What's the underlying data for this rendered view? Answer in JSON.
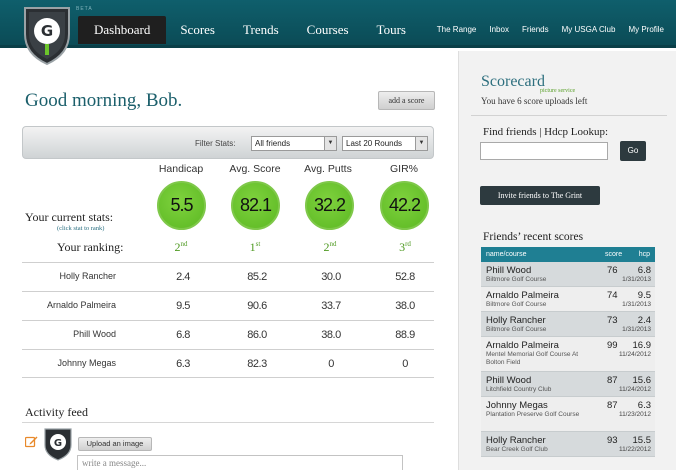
{
  "nav": {
    "items": [
      "Dashboard",
      "Scores",
      "Trends",
      "Courses",
      "Tours"
    ],
    "beta_label": "BETA",
    "utils": [
      "The Range",
      "Inbox",
      "Friends",
      "My USGA Club",
      "My Profile"
    ]
  },
  "colors": {
    "header": "#0b4b56",
    "accent_green": "#6cc52b",
    "teal": "#1f7f93"
  },
  "main": {
    "greeting": "Good morning, Bob.",
    "add_score": "add a score",
    "filter_label": "Filter Stats:",
    "filter_friends": "All friends",
    "filter_rounds": "Last 20 Rounds",
    "stat_heads": [
      "Handicap",
      "Avg. Score",
      "Avg. Putts",
      "GIR%"
    ],
    "current_values": [
      "5.5",
      "82.1",
      "32.2",
      "42.2"
    ],
    "current_label": "Your current stats:",
    "click_note": "(click stat to rank)",
    "ranking_label": "Your ranking:",
    "ranks": [
      {
        "num": "2",
        "suf": "nd"
      },
      {
        "num": "1",
        "suf": "st"
      },
      {
        "num": "2",
        "suf": "nd"
      },
      {
        "num": "3",
        "suf": "rd"
      }
    ],
    "friends": [
      {
        "name": "Holly Rancher",
        "values": [
          "2.4",
          "85.2",
          "30.0",
          "52.8"
        ]
      },
      {
        "name": "Arnaldo Palmeira",
        "values": [
          "9.5",
          "90.6",
          "33.7",
          "38.0"
        ]
      },
      {
        "name": "Phill Wood",
        "values": [
          "6.8",
          "86.0",
          "38.0",
          "88.9"
        ]
      },
      {
        "name": "Johnny Megas",
        "values": [
          "6.3",
          "82.3",
          "0",
          "0"
        ]
      }
    ],
    "activity_title": "Activity feed",
    "upload_label": "Upload an image",
    "message_placeholder": "write a message..."
  },
  "sidebar": {
    "scorecard_title": "Scorecard",
    "picture_service": "picture service",
    "uploads_left": "You have 6 score uploads left",
    "find_title": "Find friends | Hdcp Lookup:",
    "go_label": "Go",
    "invite_label": "Invite friends to The Grint",
    "recent_title": "Friends’ recent scores",
    "recent_headers": {
      "name": "name/course",
      "score": "score",
      "hcp": "hcp"
    },
    "recent": [
      {
        "name": "Phill Wood",
        "course": "Biltmore Golf Course",
        "score": "76",
        "hcp": "6.8",
        "date": "1/31/2013"
      },
      {
        "name": "Arnaldo Palmeira",
        "course": "Biltmore Golf Course",
        "score": "74",
        "hcp": "9.5",
        "date": "1/31/2013"
      },
      {
        "name": "Holly Rancher",
        "course": "Biltmore Golf Course",
        "score": "73",
        "hcp": "2.4",
        "date": "1/31/2013"
      },
      {
        "name": "Arnaldo Palmeira",
        "course": "Mentel Memorial Golf Course At Bolton Field",
        "score": "99",
        "hcp": "16.9",
        "date": "11/24/2012"
      },
      {
        "name": "Phill Wood",
        "course": "Litchfield Country Club",
        "score": "87",
        "hcp": "15.6",
        "date": "11/24/2012"
      },
      {
        "name": "Johnny Megas",
        "course": "Plantation Preserve Golf Course",
        "score": "87",
        "hcp": "6.3",
        "date": "11/23/2012"
      },
      {
        "name": "Holly Rancher",
        "course": "Bear Creek Golf Club",
        "score": "93",
        "hcp": "15.5",
        "date": "11/22/2012"
      }
    ]
  }
}
